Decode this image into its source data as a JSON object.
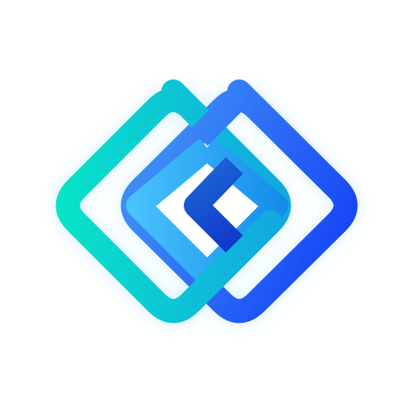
{
  "logo": {
    "name": "interlocking-diamonds-logo",
    "colors": {
      "background": "#ffffff",
      "left_diamond_start": "#07E7C6",
      "left_diamond_end": "#12A9E0",
      "right_diamond_start": "#3D8CF6",
      "right_diamond_end": "#1340F5",
      "inner_diamond_start": "#4FC8FF",
      "inner_diamond_end": "#0F86E8",
      "core_start": "#1D6FD8",
      "core_end": "#1133C8",
      "glow": "#7FD6FF"
    }
  }
}
